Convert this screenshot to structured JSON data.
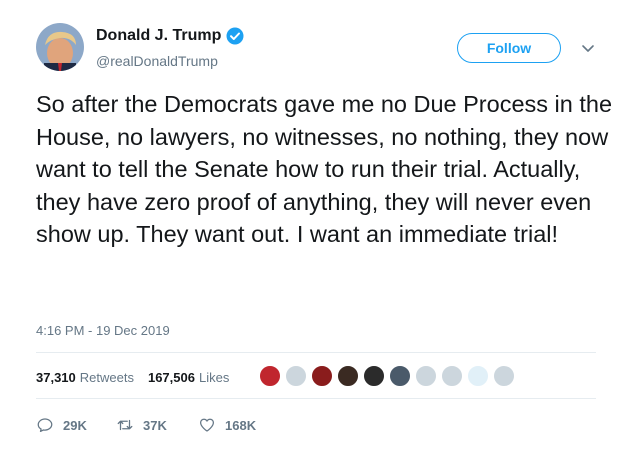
{
  "header": {
    "display_name": "Donald J. Trump",
    "handle": "@realDonaldTrump",
    "follow_label": "Follow"
  },
  "tweet": {
    "text": "So after the Democrats gave me no Due Process in the House, no lawyers, no witnesses, no nothing, they now want to tell the Senate how to run their trial. Actually, they have zero proof of anything, they will never even show up. They want out. I want an immediate trial!",
    "timestamp": "4:16 PM - 19 Dec 2019"
  },
  "stats": {
    "retweets_count": "37,310",
    "retweets_label": "Retweets",
    "likes_count": "167,506",
    "likes_label": "Likes"
  },
  "likers": [
    {
      "name": "liker-1",
      "color": "#c0262e"
    },
    {
      "name": "liker-2",
      "color": "#ccd6dd"
    },
    {
      "name": "liker-3",
      "color": "#8a1c1c"
    },
    {
      "name": "liker-4",
      "color": "#3a2a22"
    },
    {
      "name": "liker-5",
      "color": "#2b2b2b"
    },
    {
      "name": "liker-6",
      "color": "#4a5a6a"
    },
    {
      "name": "liker-7",
      "color": "#ccd6dd"
    },
    {
      "name": "liker-8",
      "color": "#ccd6dd"
    },
    {
      "name": "liker-9",
      "color": "#e1f0f8"
    },
    {
      "name": "liker-10",
      "color": "#ccd6dd"
    }
  ],
  "actions": {
    "replies": "29K",
    "retweets": "37K",
    "likes": "168K"
  },
  "colors": {
    "accent": "#1da1f2",
    "text": "#14171a",
    "muted": "#657786",
    "divider": "#e6ecf0"
  }
}
